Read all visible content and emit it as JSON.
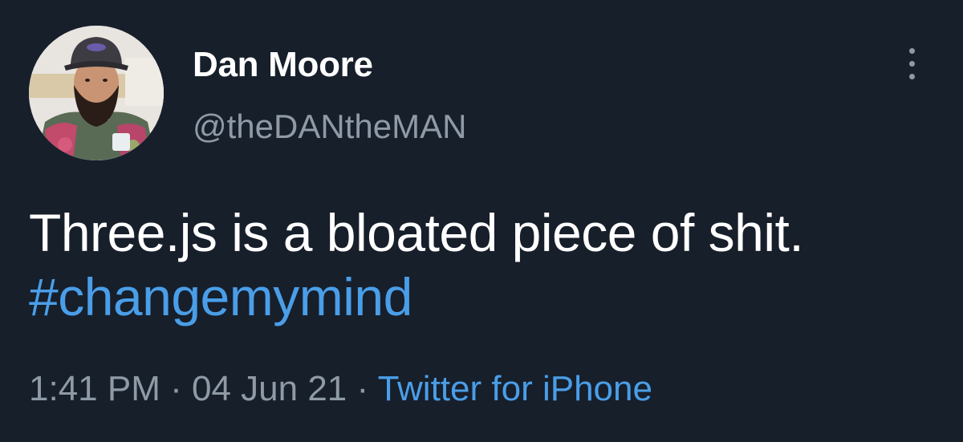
{
  "tweet": {
    "author": {
      "display_name": "Dan Moore",
      "handle": "@theDANtheMAN",
      "avatar_icon": "user-avatar"
    },
    "text_before": "Three.js is a bloated piece of shit. ",
    "hashtag": "#changemymind",
    "meta": {
      "time": "1:41 PM",
      "separator_1": " · ",
      "date": "04 Jun 21",
      "separator_2": " · ",
      "source": "Twitter for iPhone"
    },
    "more_icon": "more-vertical-icon"
  },
  "colors": {
    "background": "#171f2b",
    "text_primary": "#ffffff",
    "text_secondary": "#8f9aa7",
    "link": "#4a9ee8"
  }
}
